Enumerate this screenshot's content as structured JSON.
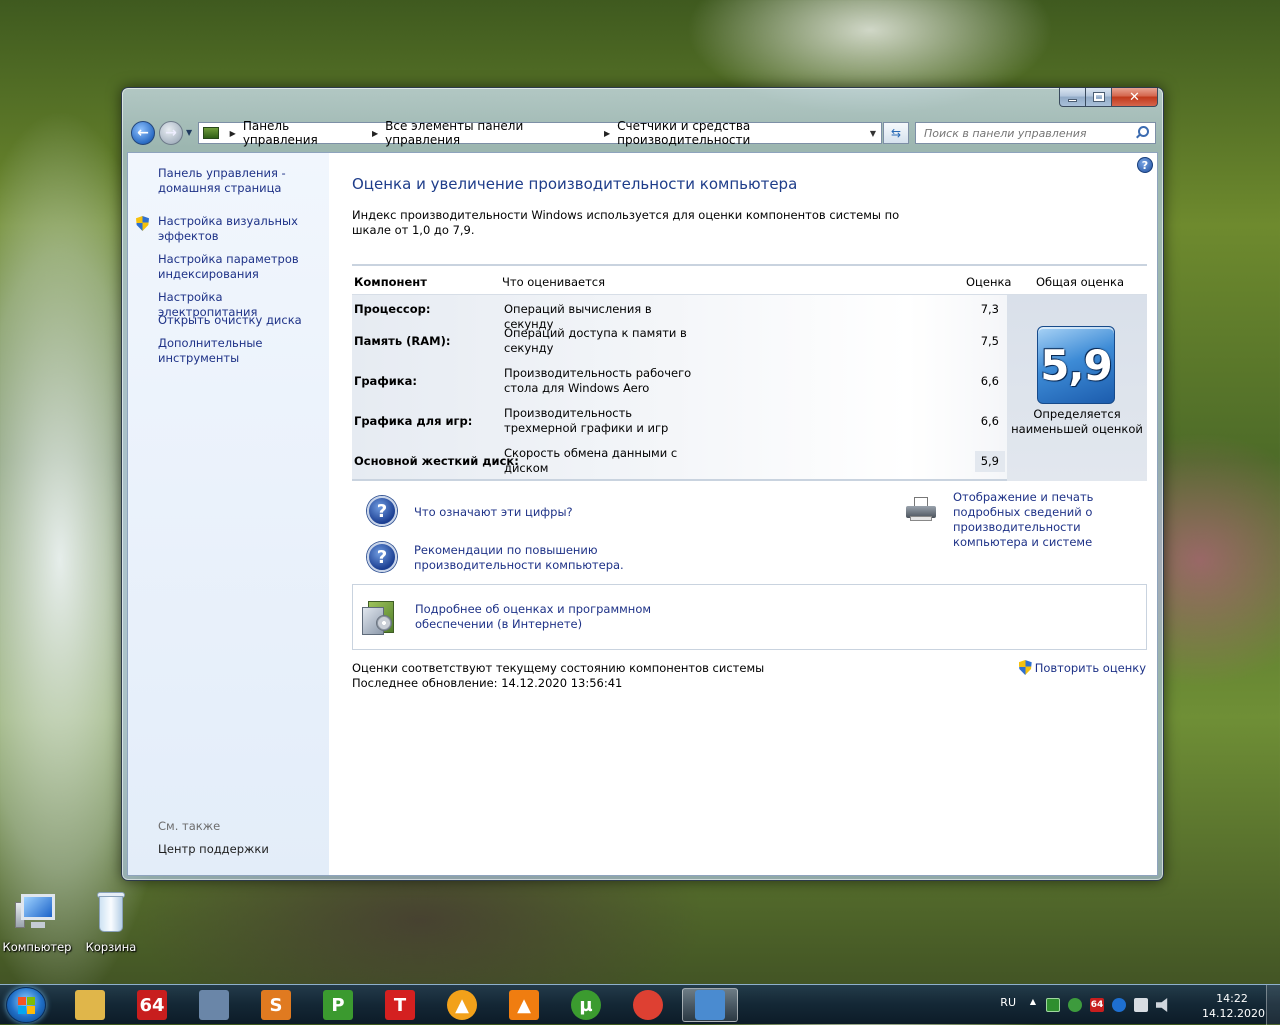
{
  "nav": {
    "breadcrumbs": [
      "Панель управления",
      "Все элементы панели управления",
      "Счетчики и средства производительности"
    ],
    "search_placeholder": "Поиск в панели управления"
  },
  "sidebar": {
    "items": [
      {
        "label": "Панель управления - домашняя страница"
      },
      {
        "label": "Настройка визуальных эффектов"
      },
      {
        "label": "Настройка параметров индексирования"
      },
      {
        "label": "Настройка электропитания"
      },
      {
        "label": "Открыть очистку диска"
      },
      {
        "label": "Дополнительные инструменты"
      }
    ],
    "see_also": "См. также",
    "support": "Центр поддержки"
  },
  "main": {
    "title": "Оценка и увеличение производительности компьютера",
    "intro": "Индекс производительности Windows используется для оценки компонентов системы по шкале от 1,0 до 7,9.",
    "table": {
      "headers": {
        "component": "Компонент",
        "what": "Что оценивается",
        "score": "Оценка",
        "base": "Общая оценка"
      },
      "rows": [
        {
          "component": "Процессор:",
          "what": "Операций вычисления в секунду",
          "score": "7,3"
        },
        {
          "component": "Память (RAM):",
          "what": "Операций доступа к памяти в секунду",
          "score": "7,5"
        },
        {
          "component": "Графика:",
          "what": "Производительность рабочего стола для Windows Aero",
          "score": "6,6"
        },
        {
          "component": "Графика для игр:",
          "what": "Производительность трехмерной графики и игр",
          "score": "6,6"
        },
        {
          "component": "Основной жесткий диск:",
          "what": "Скорость обмена данными с диском",
          "score": "5,9"
        }
      ],
      "base_score": "5,9",
      "base_caption": "Определяется наименьшей оценкой"
    },
    "links": {
      "what_numbers": "Что означают эти цифры?",
      "recommendations": "Рекомендации по повышению производительности компьютера.",
      "print_details": "Отображение и печать подробных сведений о производительности компьютера и системе",
      "online_info": "Подробнее об оценках и программном обеспечении (в Интернете)"
    },
    "status_line": "Оценки соответствуют текущему состоянию компонентов системы",
    "last_update": "Последнее обновление: 14.12.2020 13:56:41",
    "rerun": "Повторить оценку"
  },
  "desktop": {
    "icons": [
      {
        "label": "Компьютер",
        "icon": "computer-icon"
      },
      {
        "label": "Корзина",
        "icon": "recycle-bin-icon"
      }
    ]
  },
  "taskbar": {
    "apps": [
      {
        "name": "explorer-icon",
        "glyph": "",
        "color": "#e0b64a"
      },
      {
        "name": "aida64-icon",
        "glyph": "64",
        "color": "#c81e1e"
      },
      {
        "name": "drive-tool-icon",
        "glyph": "",
        "color": "#6a86a8"
      },
      {
        "name": "sheets-icon",
        "glyph": "S",
        "color": "#e07a20"
      },
      {
        "name": "presentation-icon",
        "glyph": "P",
        "color": "#3b9a2f"
      },
      {
        "name": "text-editor-icon",
        "glyph": "T",
        "color": "#d42020"
      },
      {
        "name": "aimp-icon",
        "glyph": "▲",
        "color": "#f2a11a"
      },
      {
        "name": "vlc-icon",
        "glyph": "▲",
        "color": "#f07d10"
      },
      {
        "name": "utorrent-icon",
        "glyph": "µ",
        "color": "#3b9b2f"
      },
      {
        "name": "chrome-icon",
        "glyph": "",
        "color": "#de4032"
      },
      {
        "name": "performance-window-icon",
        "glyph": "",
        "color": "#4a8bd0"
      }
    ],
    "lang": "RU",
    "time": "14:22",
    "date": "14.12.2020"
  }
}
